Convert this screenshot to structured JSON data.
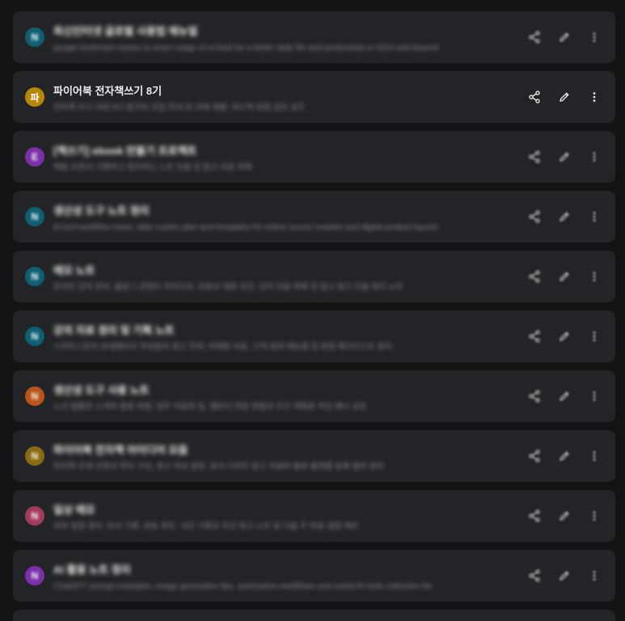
{
  "colors": {
    "page_bg": "#121314",
    "card_bg": "#232427",
    "title_text": "#ececec",
    "desc_text": "#8c8c8f"
  },
  "icons": {
    "share": "share-icon",
    "edit": "pencil-icon",
    "more": "more-vertical-icon"
  },
  "books": [
    {
      "badge": "N",
      "badge_color": "#0f5f73",
      "title": "최신인터넷 글로벌 사용법 매뉴얼",
      "description": "google bookmark classic & smart usage of ai tools for a better daily life and productivity in 2024 and beyond",
      "blurred": true
    },
    {
      "badge": "파",
      "badge_color": "#b8860b",
      "title": "파이어북 전자책쓰기 8기",
      "description": "전자책 쓰기 과정 8기 참가자 모임 안내 및 과제 제출, 피드백 일정 공유 공간",
      "blurred": true,
      "title_clear": true
    },
    {
      "badge": "E",
      "badge_color": "#7b2fa8",
      "title": "[책쓰기] ebook 만들기 프로젝트",
      "description": "책을 쓰면서 기록하고 정리하는 노트 모음 및 참고 자료 목록",
      "blurred": true
    },
    {
      "badge": "N",
      "badge_color": "#0f5f73",
      "title": "생산성 도구 노트 정리",
      "description": "AI tool workflow notes, daily routine plan and templates for online course creation and digital product launch",
      "blurred": true
    },
    {
      "badge": "N",
      "badge_color": "#0f5f73",
      "title": "메모 노트",
      "description": "온라인 강의 준비, 블로그 콘텐츠 아이디어, 유튜브 대본 초안, 강의 자료 목록 및 참고 링크 모음 정리 노트",
      "blurred": true
    },
    {
      "badge": "N",
      "badge_color": "#0f5f73",
      "title": "강의 자료 정리 및 기획 노트",
      "description": "스마트스토어 상세페이지 작성법과 광고 전략, 마케팅 자료, 고객 응대 매뉴얼 및 운영 체크리스트 정리",
      "blurred": true
    },
    {
      "badge": "N",
      "badge_color": "#b8541a",
      "title": "생산성 도구 사용 노트",
      "description": "노션 템플릿 소개와 활용 방법, 업무 자동화 팁, 캘린더 연동 방법과 주간 계획표 작성 예시 공유",
      "blurred": true
    },
    {
      "badge": "N",
      "badge_color": "#8a6a10",
      "title": "파이어북 전자책 아이디어 모음",
      "description": "전자책 주제 선정과 목차 구성, 원고 작성 일정, 표지 디자인 참고 자료와 출판 플랫폼 등록 절차 정리",
      "blurred": true
    },
    {
      "badge": "N",
      "badge_color": "#a33a5e",
      "title": "일상 메모",
      "description": "하루 일정 정리, 독서 기록, 운동 루틴, 식단 기록과 주간 회고 노트 및 다음 주 목표 설정 메모",
      "blurred": true
    },
    {
      "badge": "N",
      "badge_color": "#7b2fa8",
      "title": "AI 활용 노트 정리",
      "description": "ChatGPT prompt examples, image generation tips, automation workflows and useful AI tools collection list",
      "blurred": true
    }
  ]
}
